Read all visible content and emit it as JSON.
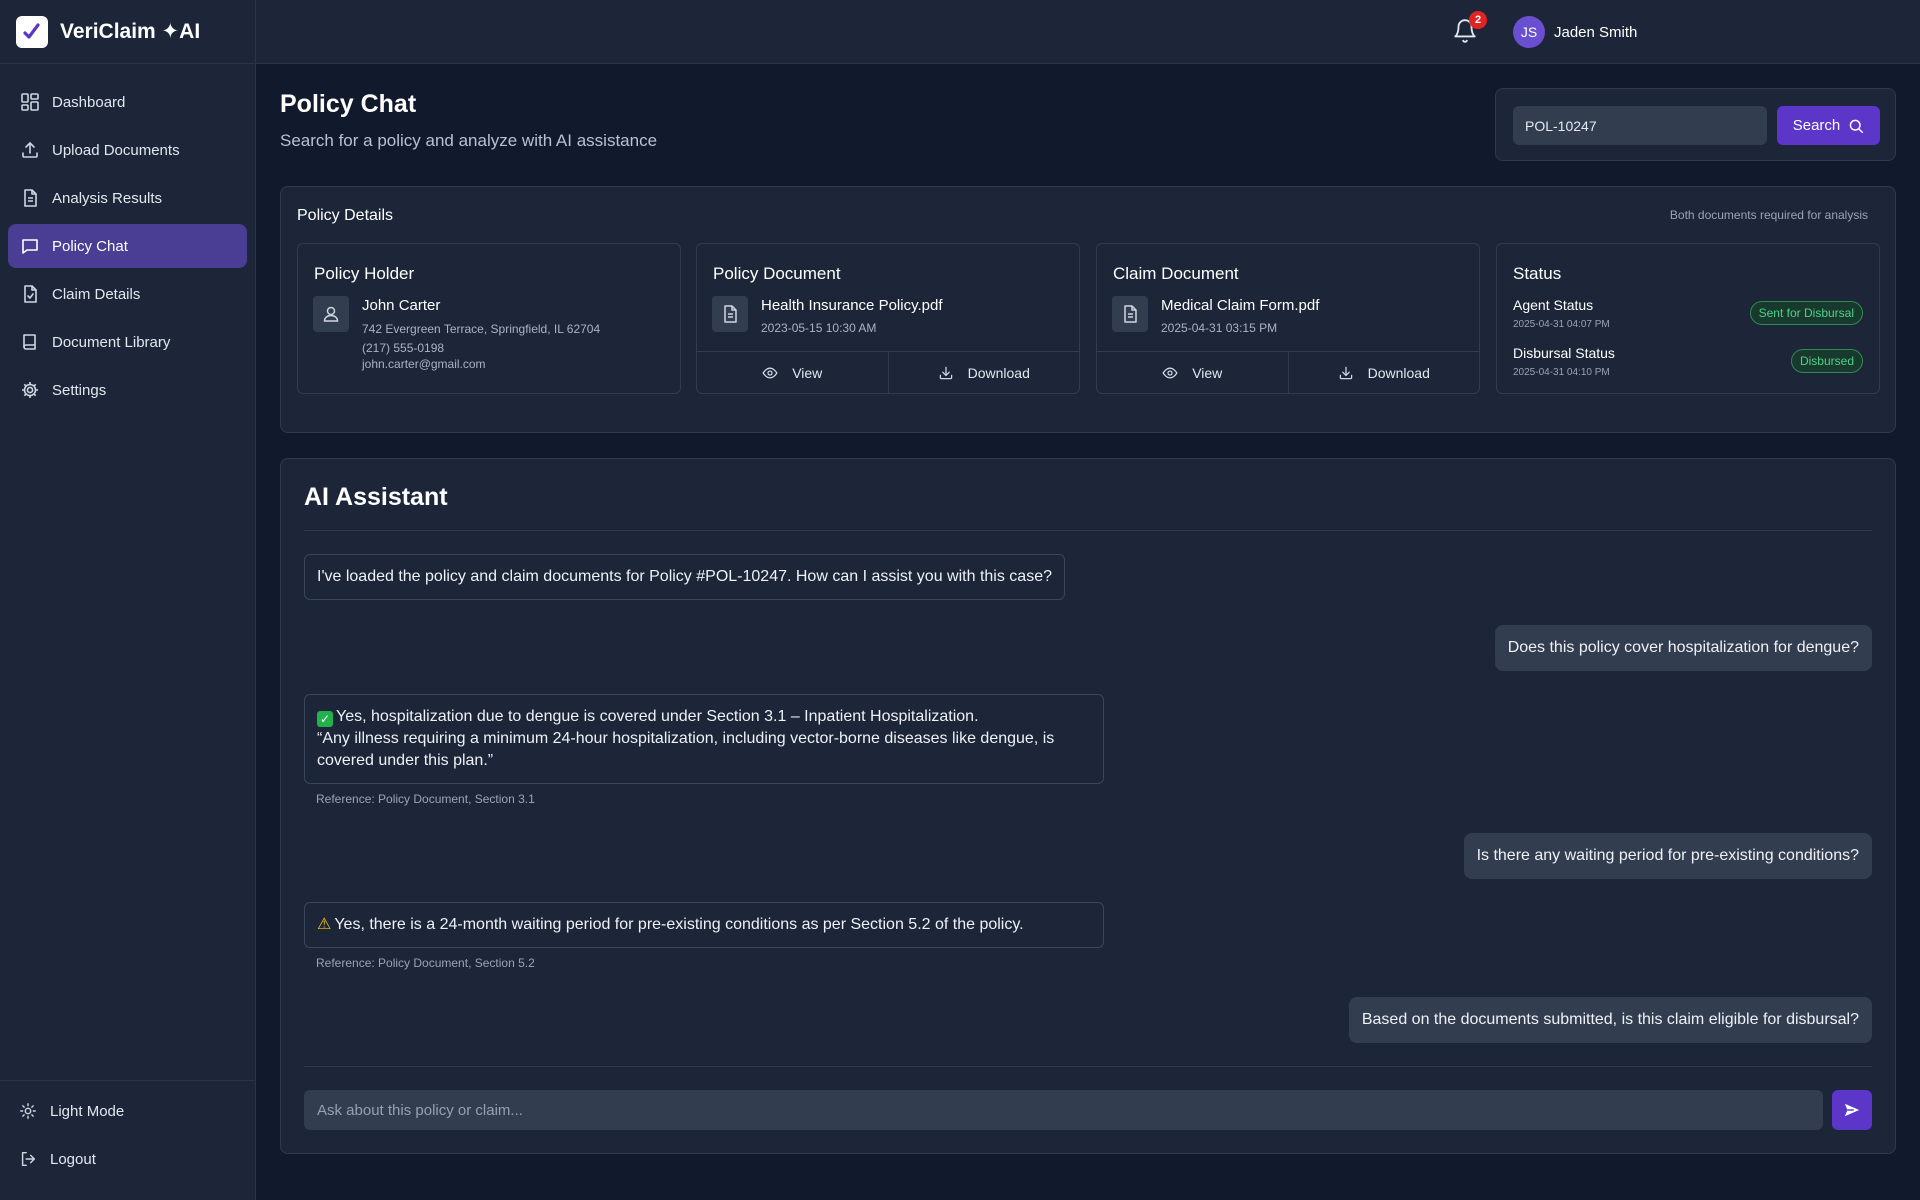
{
  "app": {
    "name": "VeriClaim ✦AI"
  },
  "sidebar": {
    "items": [
      {
        "label": "Dashboard",
        "icon": "dashboard-icon"
      },
      {
        "label": "Upload Documents",
        "icon": "upload-icon"
      },
      {
        "label": "Analysis Results",
        "icon": "file-text-icon"
      },
      {
        "label": "Policy Chat",
        "icon": "chat-icon",
        "active": true
      },
      {
        "label": "Claim Details",
        "icon": "file-check-icon"
      },
      {
        "label": "Document Library",
        "icon": "book-icon"
      },
      {
        "label": "Settings",
        "icon": "gear-icon"
      }
    ],
    "bottom": [
      {
        "label": "Light Mode",
        "icon": "sun-icon"
      },
      {
        "label": "Logout",
        "icon": "logout-icon"
      }
    ]
  },
  "topbar": {
    "notification_count": "2",
    "user": {
      "initials": "JS",
      "name": "Jaden Smith"
    }
  },
  "page": {
    "title": "Policy Chat",
    "subtitle": "Search for a policy and analyze with AI assistance"
  },
  "search": {
    "value": "POL-10247",
    "button_label": "Search"
  },
  "policy_details": {
    "title": "Policy Details",
    "note": "Both documents required for analysis",
    "holder": {
      "title": "Policy Holder",
      "name": "John Carter",
      "address": "742 Evergreen Terrace, Springfield, IL 62704",
      "phone": "(217) 555-0198",
      "email": "john.carter@gmail.com"
    },
    "policy_document": {
      "title": "Policy Document",
      "file_name": "Health Insurance Policy.pdf",
      "date": "2023-05-15 10:30 AM",
      "view_label": "View",
      "download_label": "Download"
    },
    "claim_document": {
      "title": "Claim Document",
      "file_name": "Medical Claim Form.pdf",
      "date": "2025-04-31 03:15 PM",
      "view_label": "View",
      "download_label": "Download"
    },
    "status": {
      "title": "Status",
      "agent_label": "Agent Status",
      "agent_date": "2025-04-31 04:07 PM",
      "agent_badge": "Sent for Disbursal",
      "disbursal_label": "Disbursal Status",
      "disbursal_date": "2025-04-31 04:10 PM",
      "disbursal_badge": "Disbursed"
    }
  },
  "assistant": {
    "title": "AI Assistant",
    "messages": {
      "m1": "I've loaded the policy and claim documents for Policy #POL-10247. How can I assist you with this case?",
      "m2": "Does this policy cover hospitalization for dengue?",
      "m3_line1": "Yes, hospitalization due to dengue is covered under Section 3.1 – Inpatient Hospitalization.",
      "m3_line2": " “Any illness requiring a minimum 24-hour hospitalization, including vector-borne diseases like dengue, is covered under this plan.”",
      "m3_ref": "Reference: Policy Document, Section 3.1",
      "m4": "Is there any waiting period for pre-existing conditions?",
      "m5": "Yes, there is a 24-month waiting period for pre-existing conditions as per Section 5.2 of the policy.",
      "m5_ref": "Reference: Policy Document, Section 5.2",
      "m6": "Based on the documents submitted, is this claim eligible for disbursal?"
    },
    "input_placeholder": "Ask about this policy or claim..."
  },
  "colors": {
    "accent": "#5b36c9",
    "active_nav": "#4a3d94",
    "success": "#4fd08a",
    "badge_red": "#e02424"
  }
}
